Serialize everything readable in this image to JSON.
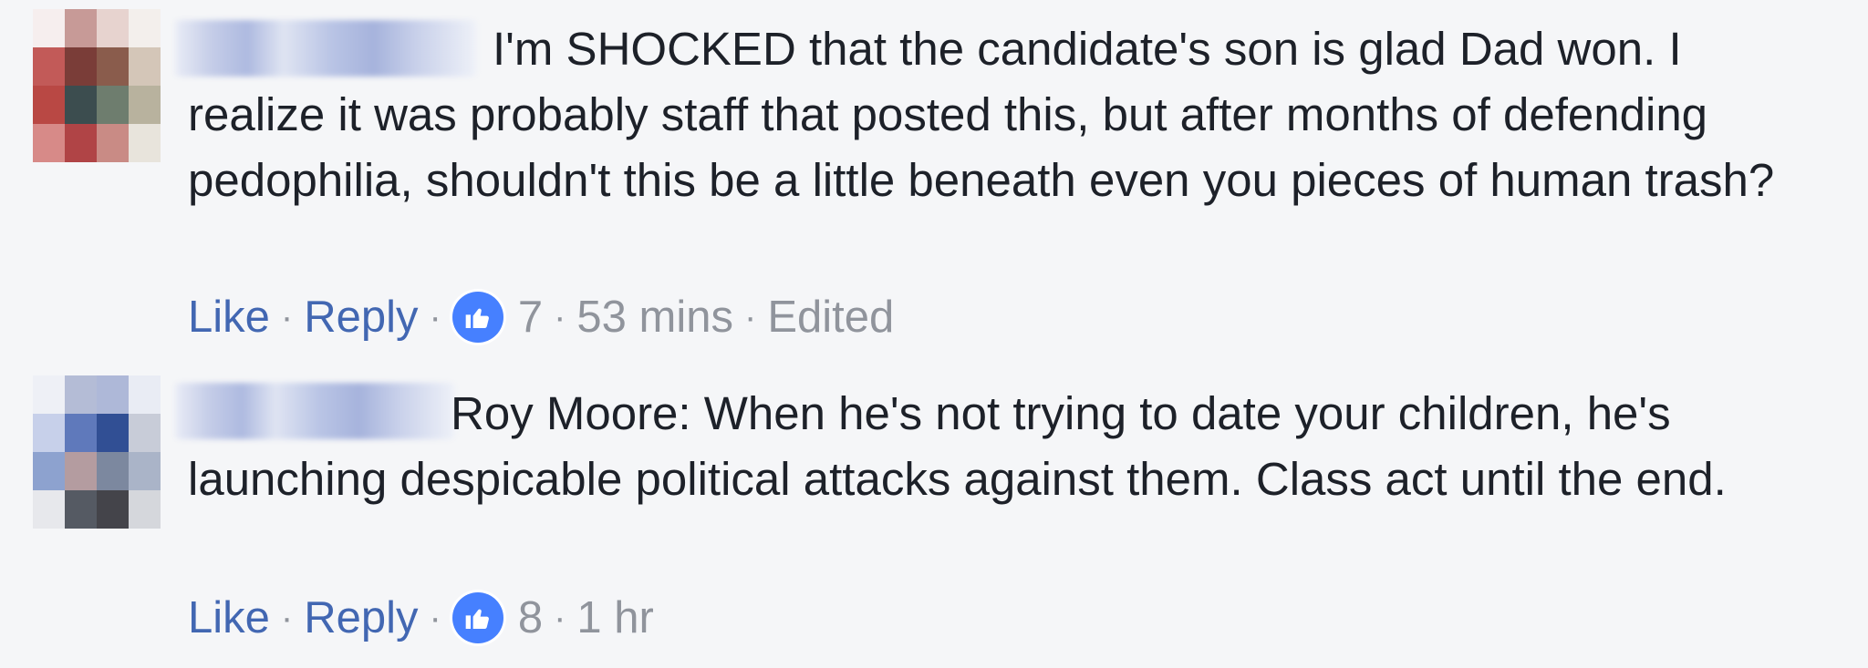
{
  "comments": [
    {
      "text": "I'm SHOCKED that the candidate's son is glad Dad won. I realize it was probably staff that posted this, but after months of defending pedophilia, shouldn't this be a little beneath even you pieces of human trash?",
      "actions": {
        "like": "Like",
        "reply": "Reply",
        "reaction_count": "7",
        "time": "53 mins",
        "edited": "Edited"
      }
    },
    {
      "text": "Roy Moore: When he's not trying to date your children, he's launching despicable political attacks against them. Class act until the end.",
      "actions": {
        "like": "Like",
        "reply": "Reply",
        "reaction_count": "8",
        "time": "1 hr"
      }
    }
  ],
  "icons": {
    "reaction": "thumbs-up-icon"
  },
  "colors": {
    "background": "#f5f6f8",
    "link": "#4267b2",
    "meta": "#90949c",
    "text": "#1d2129",
    "like_badge": "#4680ff"
  }
}
